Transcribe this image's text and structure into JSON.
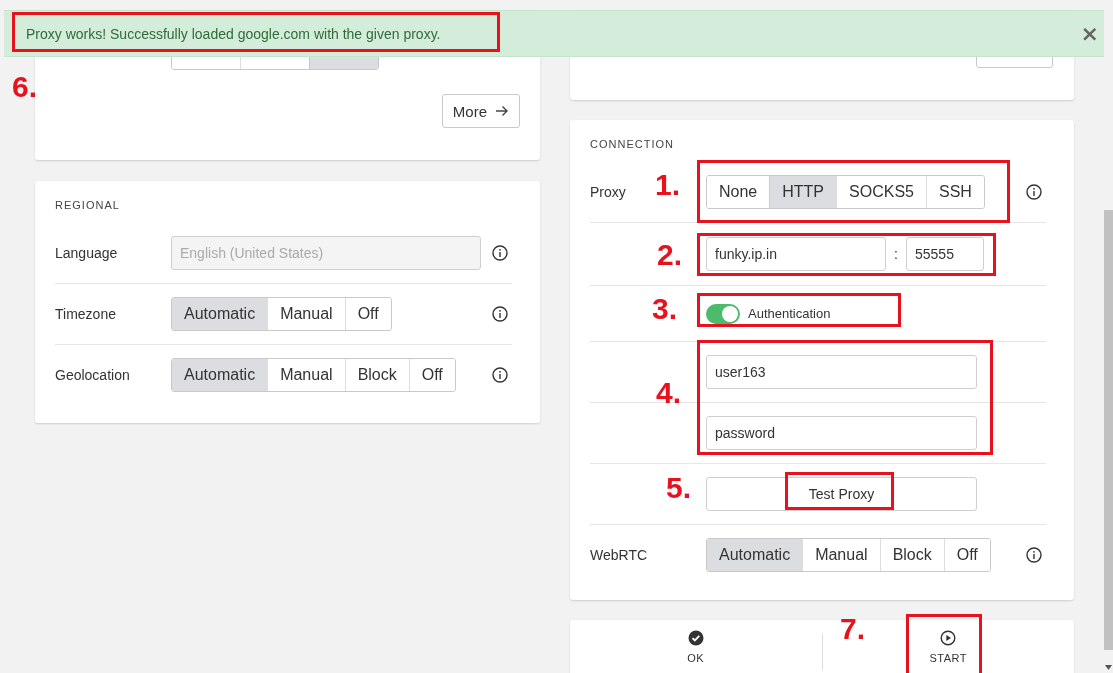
{
  "notification": {
    "text": "Proxy works! Successfully loaded google.com with the given proxy.",
    "close": "×"
  },
  "top_left_card": {
    "segments": [
      {
        "selected": false
      },
      {
        "selected": false
      },
      {
        "selected": true
      }
    ],
    "more_button": "More"
  },
  "regional": {
    "title": "REGIONAL",
    "rows": [
      {
        "kind": "input",
        "label": "Language",
        "placeholder": "English (United States)"
      },
      {
        "kind": "segmented",
        "label": "Timezone",
        "options": [
          {
            "label": "Automatic",
            "selected": true
          },
          {
            "label": "Manual",
            "selected": false
          },
          {
            "label": "Off",
            "selected": false
          }
        ]
      },
      {
        "kind": "segmented",
        "label": "Geolocation",
        "options": [
          {
            "label": "Automatic",
            "selected": true
          },
          {
            "label": "Manual",
            "selected": false
          },
          {
            "label": "Block",
            "selected": false
          },
          {
            "label": "Off",
            "selected": false
          }
        ]
      }
    ]
  },
  "connection": {
    "title": "CONNECTION",
    "proxy_label": "Proxy",
    "proxy_options": [
      {
        "label": "None",
        "selected": false
      },
      {
        "label": "HTTP",
        "selected": true
      },
      {
        "label": "SOCKS5",
        "selected": false
      },
      {
        "label": "SSH",
        "selected": false
      }
    ],
    "host": "funky.ip.in",
    "separator": ":",
    "port": "55555",
    "authentication": {
      "label": "Authentication",
      "on": true
    },
    "username": "user163",
    "password": "password",
    "test_button": "Test Proxy",
    "webrtc_label": "WebRTC",
    "webrtc_options": [
      {
        "label": "Automatic",
        "selected": true
      },
      {
        "label": "Manual",
        "selected": false
      },
      {
        "label": "Block",
        "selected": false
      },
      {
        "label": "Off",
        "selected": false
      }
    ]
  },
  "actions": [
    {
      "kind": "ok",
      "label": "OK"
    },
    {
      "kind": "start",
      "label": "START"
    }
  ],
  "annotations": [
    {
      "number": "1."
    },
    {
      "number": "2."
    },
    {
      "number": "3."
    },
    {
      "number": "4."
    },
    {
      "number": "5."
    },
    {
      "number": "6."
    },
    {
      "number": "7."
    }
  ]
}
